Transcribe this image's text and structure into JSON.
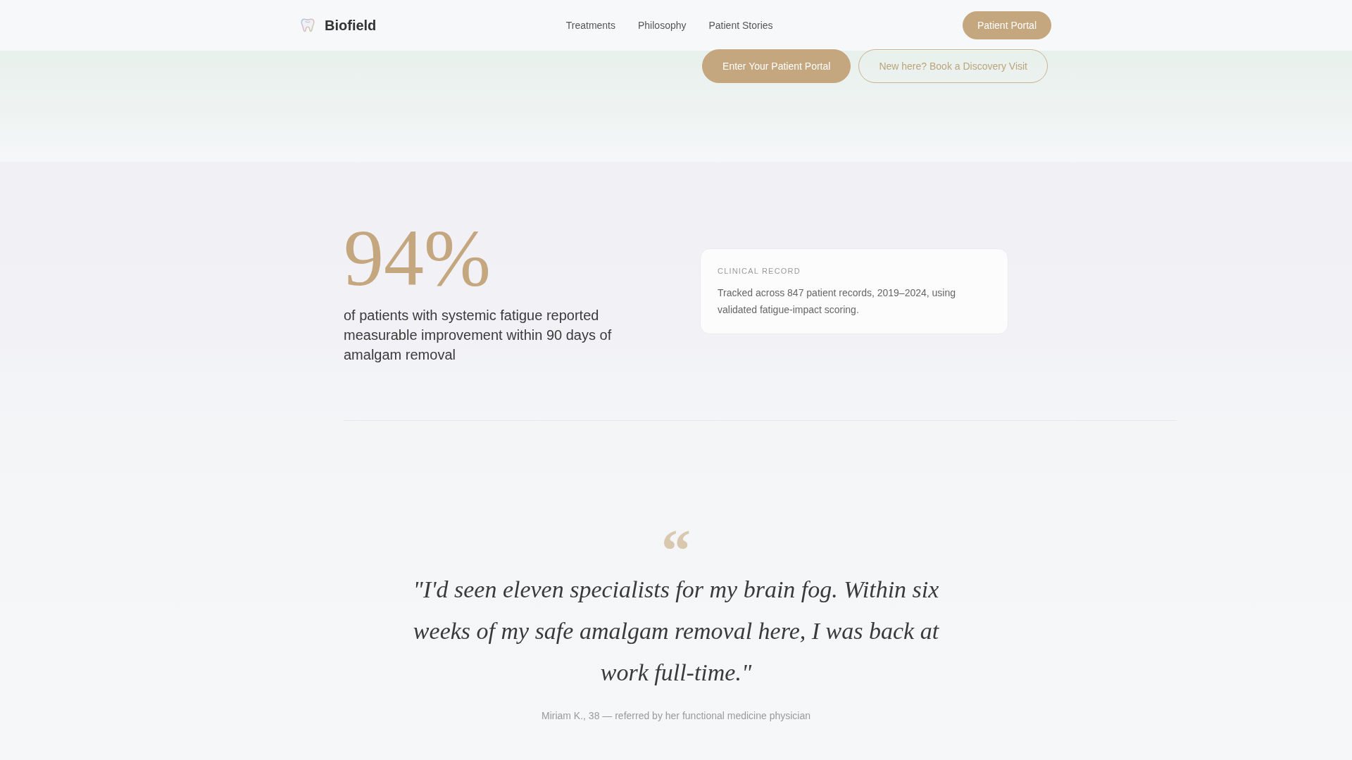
{
  "header": {
    "brand": "Biofield",
    "nav": [
      {
        "label": "Treatments"
      },
      {
        "label": "Philosophy"
      },
      {
        "label": "Patient Stories"
      }
    ],
    "cta": "Patient Portal"
  },
  "hero": {
    "buttons": [
      {
        "label": "Enter Your Patient Portal",
        "kind": "primary"
      },
      {
        "label": "New here? Book a Discovery Visit",
        "kind": "outline"
      }
    ]
  },
  "stat": {
    "value": "94%",
    "description": "of patients with systemic fatigue reported measurable improvement within 90 days of amalgam removal",
    "card": {
      "label": "CLINICAL RECORD",
      "text": "Tracked across 847 patient records, 2019–2024, using validated fatigue-impact scoring."
    }
  },
  "testimonial": {
    "quote_mark": "“",
    "quote": "\"I'd seen eleven specialists for my brain fog. Within six weeks of my safe amalgam removal here, I was back at work full-time.\"",
    "attribution": "Miriam K., 38 — referred by her functional medicine physician"
  }
}
